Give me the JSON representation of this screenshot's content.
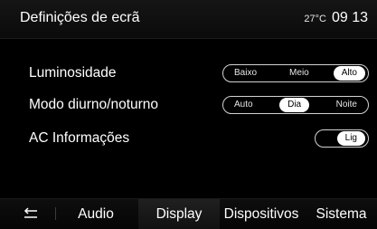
{
  "header": {
    "title": "Definições de ecrã",
    "temperature": "27°C",
    "time": "09 13"
  },
  "settings": [
    {
      "label": "Luminosidade",
      "options": [
        "Baixo",
        "Meio",
        "Alto"
      ],
      "selected": "Alto"
    },
    {
      "label": "Modo diurno/noturno",
      "options": [
        "Auto",
        "Dia",
        "Noite"
      ],
      "selected": "Dia"
    },
    {
      "label": "AC Informações",
      "options": [
        "Lig"
      ],
      "selected": "Lig"
    }
  ],
  "bottom_bar": {
    "back_icon": "back-arrow-icon",
    "tabs": [
      {
        "label": "Audio",
        "active": false
      },
      {
        "label": "Display",
        "active": true
      },
      {
        "label": "Dispositivos",
        "active": false
      },
      {
        "label": "Sistema",
        "active": false
      }
    ]
  },
  "colors": {
    "background": "#000000",
    "text": "#ffffff",
    "selected_option_bg": "#ffffff",
    "selected_option_text": "#000000"
  }
}
